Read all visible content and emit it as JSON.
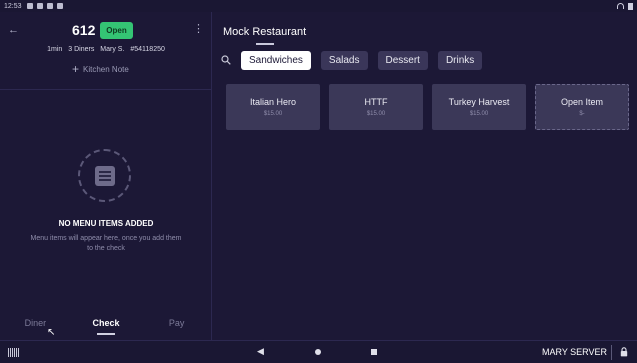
{
  "status_bar": {
    "time": "12:53"
  },
  "check": {
    "table_number": "612",
    "status": "Open",
    "elapsed": "1min",
    "diners": "3 Diners",
    "server": "Mary S.",
    "check_id": "#54118250",
    "kitchen_note_label": "Kitchen Note"
  },
  "empty_state": {
    "title": "NO MENU ITEMS ADDED",
    "subtitle": "Menu items will appear here, once you add them to the check"
  },
  "bottom_tabs": [
    {
      "label": "Diner",
      "active": false
    },
    {
      "label": "Check",
      "active": true
    },
    {
      "label": "Pay",
      "active": false
    }
  ],
  "menu": {
    "restaurant": "Mock Restaurant",
    "categories": [
      {
        "label": "Sandwiches",
        "active": true
      },
      {
        "label": "Salads",
        "active": false
      },
      {
        "label": "Dessert",
        "active": false
      },
      {
        "label": "Drinks",
        "active": false
      }
    ],
    "items": [
      {
        "name": "Italian Hero",
        "price": "$15.00"
      },
      {
        "name": "HTTF",
        "price": "$15.00"
      },
      {
        "name": "Turkey Harvest",
        "price": "$15.00"
      },
      {
        "name": "Open Item",
        "price": "$-"
      }
    ]
  },
  "nav": {
    "user": "MARY SERVER"
  },
  "colors": {
    "background": "#1c1836",
    "open_badge": "#34c474",
    "tile": "#3b3858"
  }
}
